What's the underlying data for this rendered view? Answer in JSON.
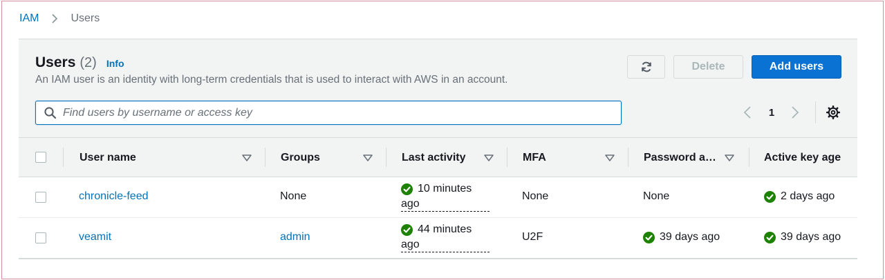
{
  "breadcrumb": {
    "root": "IAM",
    "current": "Users"
  },
  "header": {
    "title": "Users",
    "count": "(2)",
    "info": "Info",
    "description": "An IAM user is an identity with long-term credentials that is used to interact with AWS in an account."
  },
  "actions": {
    "delete": "Delete",
    "add": "Add users"
  },
  "search": {
    "placeholder": "Find users by username or access key",
    "value": ""
  },
  "pagination": {
    "page": "1"
  },
  "columns": {
    "user_name": "User name",
    "groups": "Groups",
    "last_activity": "Last activity",
    "mfa": "MFA",
    "password_age": "Password a…",
    "active_key_age": "Active key age"
  },
  "rows": [
    {
      "user_name": "chronicle-feed",
      "groups": "None",
      "last_activity_1": "10 minutes",
      "last_activity_2": "ago",
      "mfa": "None",
      "password_age": "None",
      "active_key_age": "2 days ago"
    },
    {
      "user_name": "veamit",
      "groups": "admin",
      "last_activity_1": "44 minutes",
      "last_activity_2": "ago",
      "mfa": "U2F",
      "password_age": "39 days ago",
      "active_key_age": "39 days ago"
    }
  ],
  "colors": {
    "link": "#0073bb",
    "primary": "#0972d3",
    "success": "#1d8102"
  }
}
